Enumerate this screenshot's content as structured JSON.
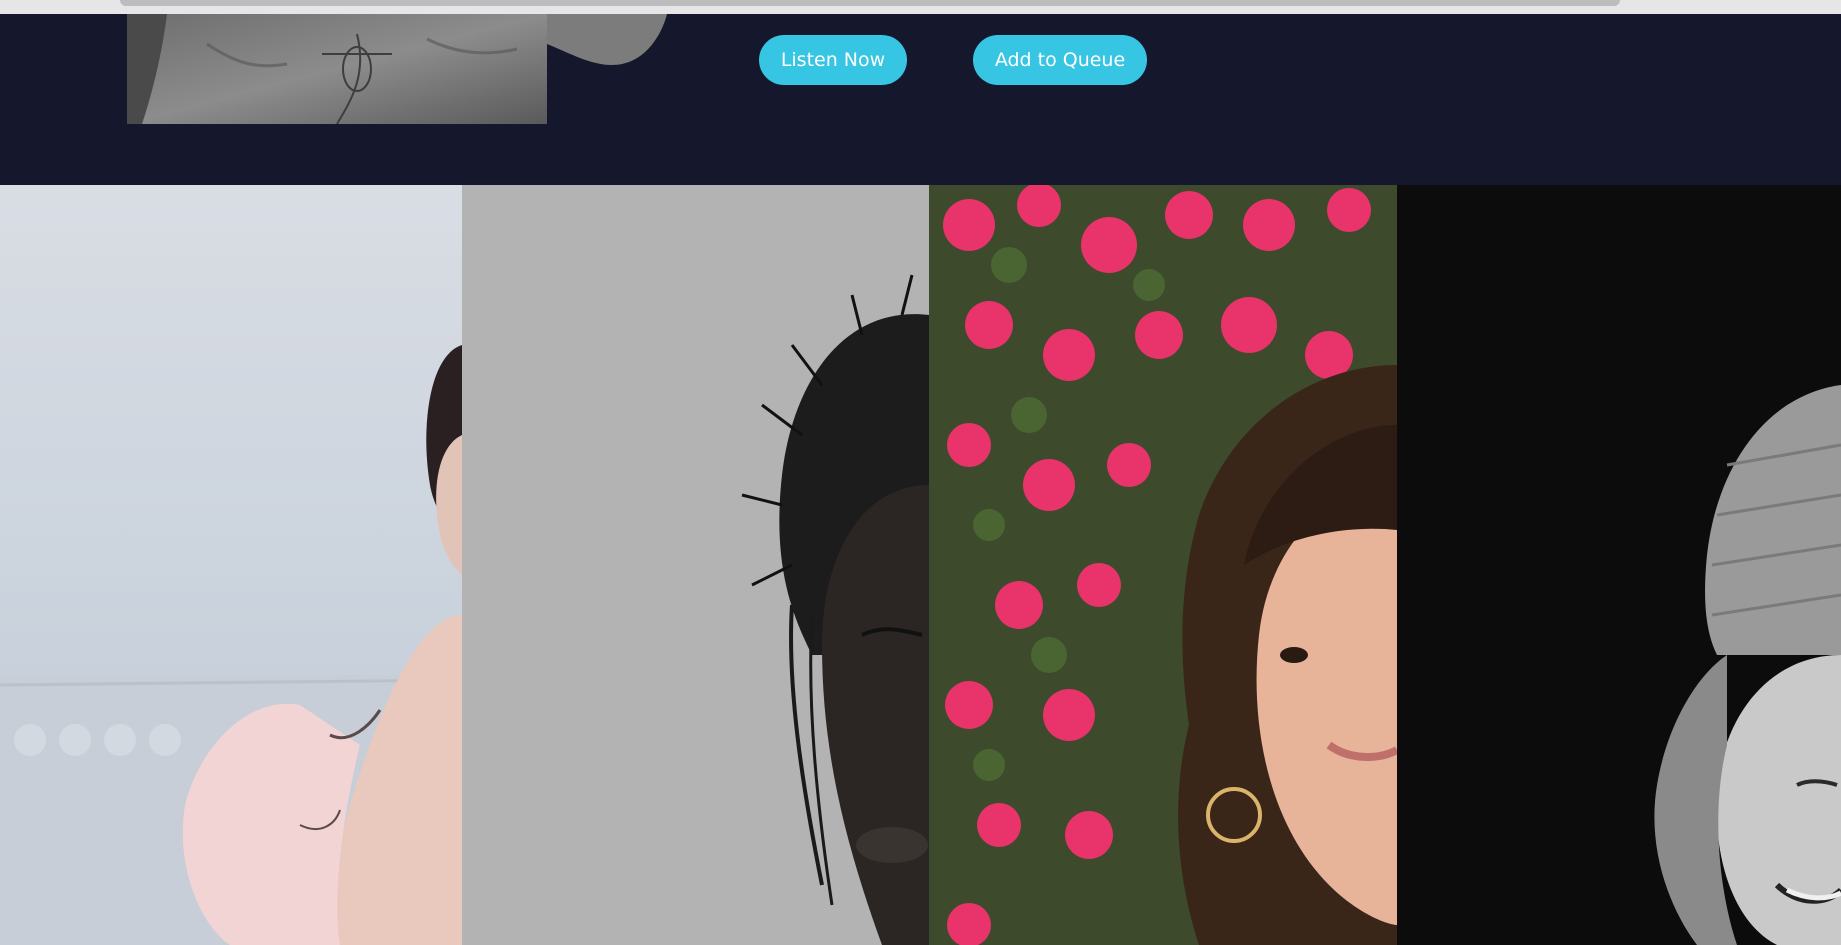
{
  "hero": {
    "listen_label": "Listen Now",
    "queue_label": "Add to Queue"
  },
  "artists": [
    {
      "id": "artist-1",
      "photo": "portrait, pink dress, butterfly tattoos"
    },
    {
      "id": "artist-2",
      "photo": "portrait, crown of thorns, black and white"
    },
    {
      "id": "artist-3",
      "photo": "portrait, pink bougainvillea, hoop earring"
    },
    {
      "id": "artist-4",
      "photo": "portrait, beanie, black and white"
    }
  ],
  "colors": {
    "background": "#15182c",
    "accent": "#36c5e2",
    "button_text": "#ffffff"
  }
}
